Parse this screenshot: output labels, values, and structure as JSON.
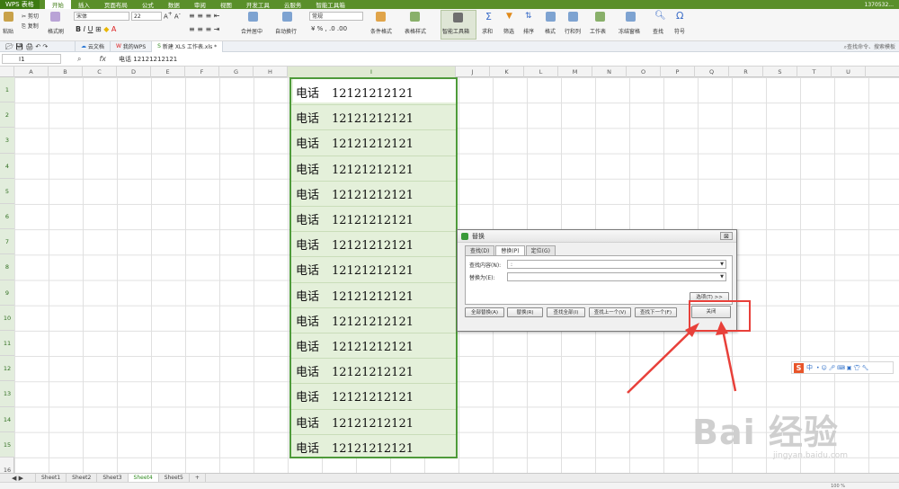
{
  "app": {
    "badge": "WPS 表格",
    "user": "1370532..."
  },
  "menu": [
    "开始",
    "插入",
    "页面布局",
    "公式",
    "数据",
    "审阅",
    "视图",
    "开发工具",
    "云服务",
    "智能工具箱"
  ],
  "ribbon": {
    "paste": "粘贴",
    "cut": "剪切",
    "copy": "复制",
    "format_painter": "格式刷",
    "font": "宋体",
    "size": "22",
    "merge": "合并居中",
    "wrap": "自动换行",
    "number_format": "常规",
    "cond_format": "条件格式",
    "table_style": "表格样式",
    "smart_toolbox": "智能工具箱",
    "sum": "求和",
    "filter": "筛选",
    "sort": "排序",
    "format": "格式",
    "row_col": "行和列",
    "sheet": "工作表",
    "freeze": "冻结窗格",
    "find": "查找",
    "symbol": "符号"
  },
  "doc_tabs": [
    "云文档",
    "我的WPS",
    "新建 XLS 工作表.xls *"
  ],
  "search_placeholder": "查找命令、搜索模板",
  "namebox": "I1",
  "fx": "fx",
  "formula": "电话    12121212121",
  "columns": [
    "A",
    "B",
    "C",
    "D",
    "E",
    "F",
    "G",
    "H",
    "I",
    "J",
    "K",
    "L",
    "M",
    "N",
    "O",
    "P",
    "Q",
    "R",
    "S",
    "T",
    "U"
  ],
  "rows": [
    "1",
    "2",
    "3",
    "4",
    "5",
    "6",
    "7",
    "8",
    "9",
    "10",
    "11",
    "12",
    "13",
    "14",
    "15",
    "16"
  ],
  "cell_label": "电话",
  "cell_number": "12121212121",
  "sheets": [
    "Sheet1",
    "Sheet2",
    "Sheet3",
    "Sheet4",
    "Sheet5"
  ],
  "active_sheet": "Sheet4",
  "dialog": {
    "title": "替换",
    "close_icon": "⊠",
    "tabs": [
      "查找(D)",
      "替换(P)",
      "定位(G)"
    ],
    "find_label": "查找内容(N):",
    "find_value": ":",
    "replace_label": "替换为(E):",
    "replace_value": "",
    "options_btn": "选项(T) >>",
    "buttons": [
      "全部替换(A)",
      "替换(R)",
      "查找全部(I)",
      "查找上一个(V)",
      "查找下一个(F)"
    ],
    "close_btn": "关闭"
  },
  "ime": "中",
  "watermark": "Bai 经验",
  "watermark_url": "jingyan.baidu.com",
  "zoom": "100 %",
  "colors": {
    "accent": "#5a8f2a",
    "selection": "#e4f0da",
    "highlight": "#e8403a"
  }
}
